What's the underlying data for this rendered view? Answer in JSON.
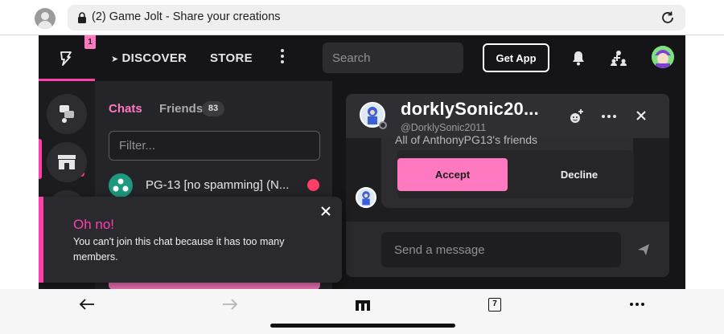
{
  "browser": {
    "url_text": "(2) Game Jolt - Share your creations",
    "tabs_count": "7"
  },
  "nav": {
    "notification_count": "1",
    "discover_label": "DISCOVER",
    "store_label": "STORE",
    "search_placeholder": "Search",
    "get_app_label": "Get App"
  },
  "chats_panel": {
    "tab_chats": "Chats",
    "tab_friends": "Friends",
    "friends_count": "83",
    "filter_placeholder": "Filter...",
    "rows": [
      {
        "name": "PG-13 [no spamming] (N..."
      }
    ]
  },
  "chat_window": {
    "title": "dorklySonic20...",
    "handle": "@DorklySonic2011",
    "invite_text": "All of AnthonyPG13's friends",
    "accept_label": "Accept",
    "decline_label": "Decline",
    "message_placeholder": "Send a message"
  },
  "toast": {
    "title": "Oh no!",
    "message": "You can't join this chat because it has too many members."
  },
  "colors": {
    "accent_pink": "#ff79c0",
    "accent_magenta": "#ff3fac",
    "unread_red": "#ff3f68",
    "background": "#151517"
  },
  "icons": {
    "logo": "game-jolt-bolt-icon",
    "bell": "bell-icon",
    "friends": "friends-icon",
    "close": "close-icon",
    "send": "send-icon"
  }
}
